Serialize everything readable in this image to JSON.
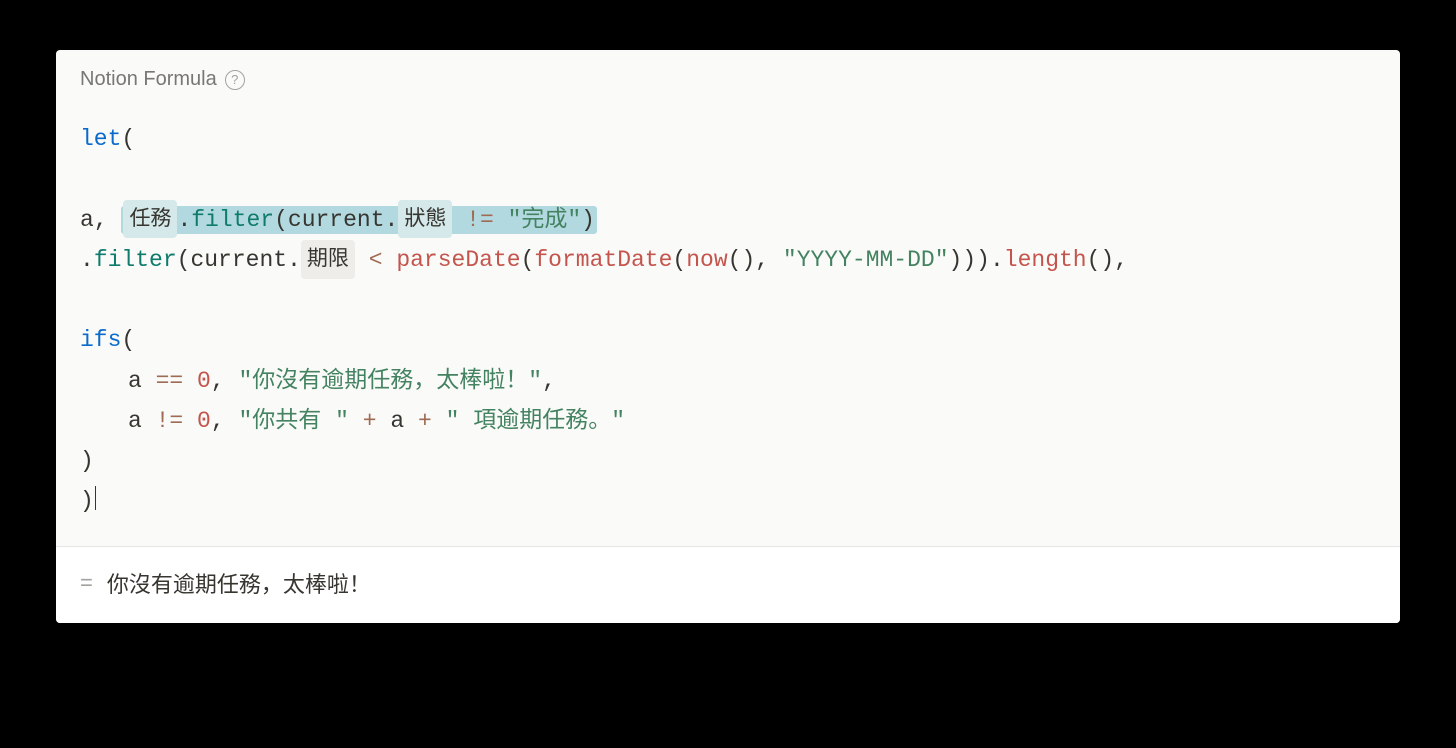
{
  "header": {
    "title": "Notion Formula",
    "help_icon_glyph": "?"
  },
  "code": {
    "kw_let": "let",
    "var_a": "a",
    "comma": ",",
    "space": " ",
    "lparen": "(",
    "rparen": ")",
    "dot": ".",
    "pill_tasks": "任務",
    "fn_filter": "filter",
    "kw_current": "current",
    "pill_status": "狀態",
    "op_ne": "!=",
    "str_done": "\"完成\"",
    "pill_deadline": "期限",
    "op_lt": "<",
    "fn_parseDate": "parseDate",
    "fn_formatDate": "formatDate",
    "fn_now": "now",
    "str_datefmt": "\"YYYY-MM-DD\"",
    "fn_length": "length",
    "kw_ifs": "ifs",
    "op_eq": "==",
    "num_zero": "0",
    "str_none": "\"你沒有逾期任務，太棒啦！\"",
    "str_prefix": "\"你共有 \"",
    "op_plus": "+",
    "str_suffix": "\" 項逾期任務。\""
  },
  "result": {
    "equals": "=",
    "text": "你沒有逾期任務，太棒啦！"
  }
}
